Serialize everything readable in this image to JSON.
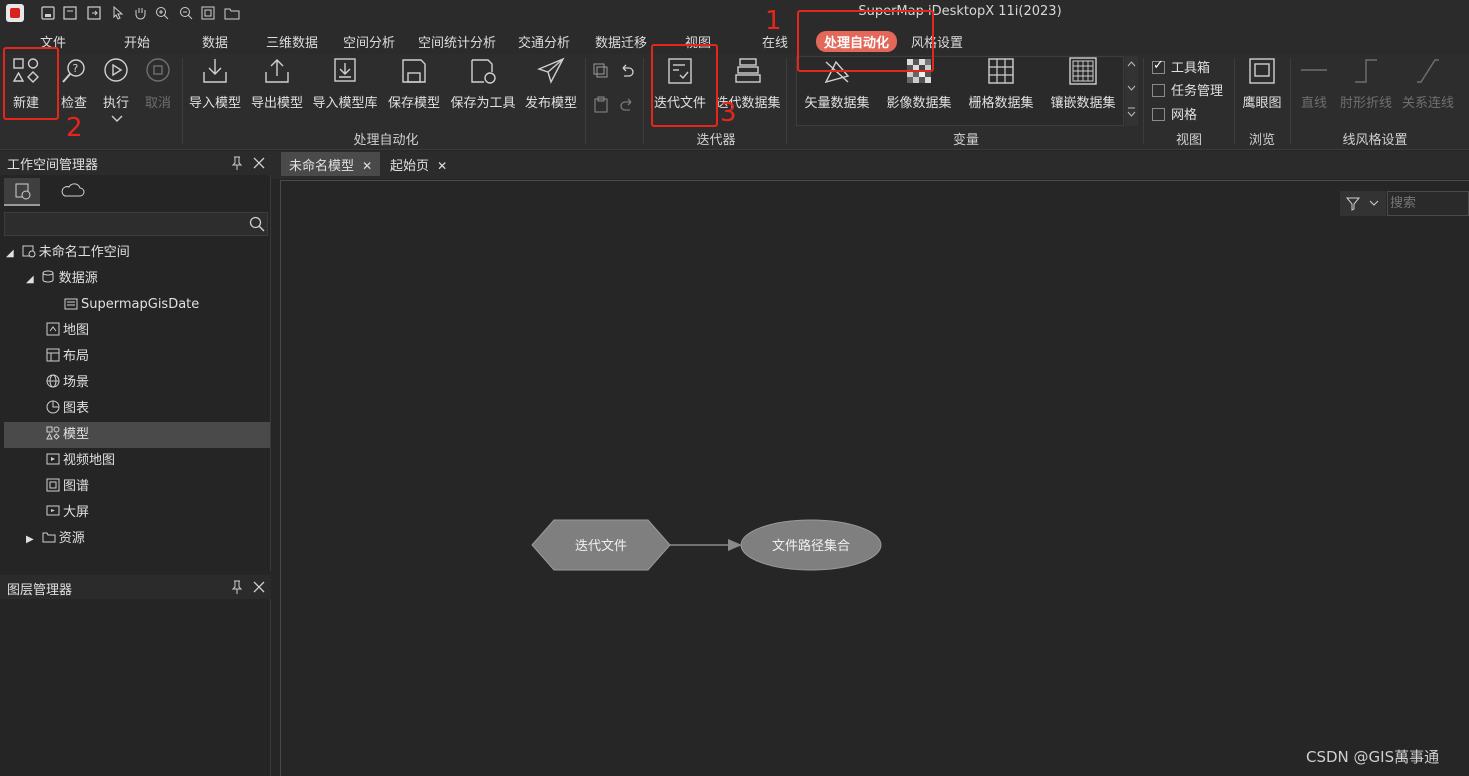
{
  "app": {
    "title": "SuperMap iDesktopX 11i(2023)"
  },
  "menu": {
    "tabs": [
      "文件",
      "开始",
      "数据",
      "三维数据",
      "空间分析",
      "空间统计分析",
      "交通分析",
      "数据迁移",
      "视图",
      "在线",
      "处理自动化",
      "风格设置"
    ],
    "active_tab": "处理自动化"
  },
  "ribbon": {
    "new_label": "新建",
    "check_label": "检查",
    "run_label": "执行",
    "cancel_label": "取消",
    "import_model": "导入模型",
    "export_model": "导出模型",
    "import_model_lib": "导入模型库",
    "save_model": "保存模型",
    "save_as_tool": "保存为工具",
    "publish_model": "发布模型",
    "group_automation": "处理自动化",
    "iter_file": "迭代文件",
    "iter_dataset": "迭代数据集",
    "group_iterator": "迭代器",
    "vector_dataset": "矢量数据集",
    "image_dataset": "影像数据集",
    "grid_dataset": "栅格数据集",
    "mosaic_dataset": "镶嵌数据集",
    "group_variable": "变量",
    "toolbox": "工具箱",
    "task_manager": "任务管理",
    "grid": "网格",
    "group_view": "视图",
    "eagle_eye": "鹰眼图",
    "group_browse": "浏览",
    "straight_line": "直线",
    "elbow_line": "肘形折线",
    "relation_line": "关系连线",
    "group_line_style": "线风格设置"
  },
  "annotations": {
    "n1": "1",
    "n2": "2",
    "n3": "3"
  },
  "workspace": {
    "title": "工作空间管理器",
    "items": {
      "root": "未命名工作空间",
      "datasource": "数据源",
      "ds_child": "SupermapGisDate",
      "map": "地图",
      "layout": "布局",
      "scene": "场景",
      "chart": "图表",
      "model": "模型",
      "video_map": "视频地图",
      "atlas": "图谱",
      "bigscreen": "大屏",
      "resource": "资源"
    }
  },
  "layers": {
    "title": "图层管理器"
  },
  "doctabs": {
    "tab1": "未命名模型",
    "tab2": "起始页"
  },
  "canvas": {
    "search_placeholder": "搜索",
    "node_iter": "迭代文件",
    "node_paths": "文件路径集合"
  },
  "watermark": "CSDN @GIS萬事通",
  "colors": {
    "accent": "#e3685a",
    "annotation": "#e5261c"
  }
}
